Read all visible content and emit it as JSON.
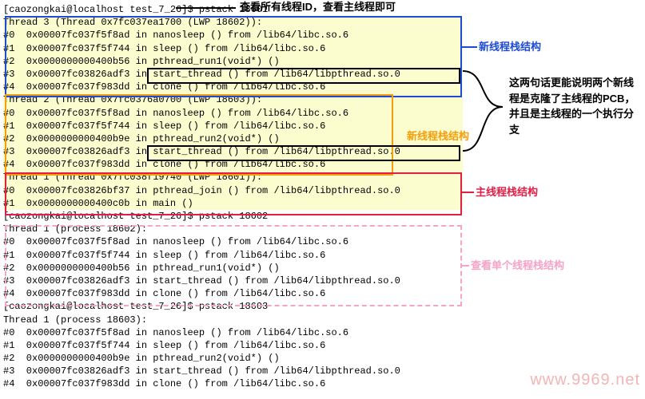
{
  "annotations": {
    "top": "查看所有线程ID，查看主线程即可",
    "blue": "新线程栈结构",
    "orange": "新线程栈结构",
    "red": "主线程栈结构",
    "pink": "查看单个线程栈结构",
    "black": "这两句话更能说明两个新线程是克隆了主线程的PCB，并且是主线程的一个执行分支"
  },
  "watermark": "www.9969.net",
  "lines": [
    {
      "cls": "prompt-line",
      "text": "[caozongkai@localhost test_7_26]$ pstack 18601"
    },
    {
      "cls": "yellowbg",
      "text": "Thread 3 (Thread 0x7fc037ea1700 (LWP 18602)):"
    },
    {
      "cls": "yellowbg",
      "text": "#0  0x00007fc037f5f8ad in nanosleep () from /lib64/libc.so.6"
    },
    {
      "cls": "yellowbg",
      "text": "#1  0x00007fc037f5f744 in sleep () from /lib64/libc.so.6"
    },
    {
      "cls": "yellowbg",
      "text": "#2  0x0000000000400b56 in pthread_run1(void*) ()"
    },
    {
      "cls": "yellowbg",
      "text": "#3  0x00007fc03826adf3 in start_thread () from /lib64/libpthread.so.0"
    },
    {
      "cls": "yellowbg",
      "text": "#4  0x00007fc037f983dd in clone () from /lib64/libc.so.6"
    },
    {
      "cls": "yellowbg",
      "text": "Thread 2 (Thread 0x7fc0376a0700 (LWP 18603)):"
    },
    {
      "cls": "yellowbg",
      "text": "#0  0x00007fc037f5f8ad in nanosleep () from /lib64/libc.so.6"
    },
    {
      "cls": "yellowbg",
      "text": "#1  0x00007fc037f5f744 in sleep () from /lib64/libc.so.6"
    },
    {
      "cls": "yellowbg",
      "text": "#2  0x0000000000400b9e in pthread_run2(void*) ()"
    },
    {
      "cls": "yellowbg",
      "text": "#3  0x00007fc03826adf3 in start_thread () from /lib64/libpthread.so.0"
    },
    {
      "cls": "yellowbg",
      "text": "#4  0x00007fc037f983dd in clone () from /lib64/libc.so.6"
    },
    {
      "cls": "yellowbg",
      "text": "Thread 1 (Thread 0x7fc038f19740 (LWP 18601)):"
    },
    {
      "cls": "yellowbg",
      "text": "#0  0x00007fc03826bf37 in pthread_join () from /lib64/libpthread.so.0"
    },
    {
      "cls": "yellowbg",
      "text": "#1  0x0000000000400c0b in main ()"
    },
    {
      "cls": "prompt-line",
      "text": "[caozongkai@localhost test_7_26]$ pstack 18602"
    },
    {
      "cls": "",
      "text": "Thread 1 (process 18602):"
    },
    {
      "cls": "",
      "text": "#0  0x00007fc037f5f8ad in nanosleep () from /lib64/libc.so.6"
    },
    {
      "cls": "",
      "text": "#1  0x00007fc037f5f744 in sleep () from /lib64/libc.so.6"
    },
    {
      "cls": "",
      "text": "#2  0x0000000000400b56 in pthread_run1(void*) ()"
    },
    {
      "cls": "",
      "text": "#3  0x00007fc03826adf3 in start_thread () from /lib64/libpthread.so.0"
    },
    {
      "cls": "",
      "text": "#4  0x00007fc037f983dd in clone () from /lib64/libc.so.6"
    },
    {
      "cls": "prompt-line",
      "text": "[caozongkai@localhost test_7_26]$ pstack 18603"
    },
    {
      "cls": "",
      "text": "Thread 1 (process 18603):"
    },
    {
      "cls": "",
      "text": "#0  0x00007fc037f5f8ad in nanosleep () from /lib64/libc.so.6"
    },
    {
      "cls": "",
      "text": "#1  0x00007fc037f5f744 in sleep () from /lib64/libc.so.6"
    },
    {
      "cls": "",
      "text": "#2  0x0000000000400b9e in pthread_run2(void*) ()"
    },
    {
      "cls": "",
      "text": "#3  0x00007fc03826adf3 in start_thread () from /lib64/libpthread.so.0"
    },
    {
      "cls": "",
      "text": "#4  0x00007fc037f983dd in clone () from /lib64/libc.so.6"
    }
  ]
}
